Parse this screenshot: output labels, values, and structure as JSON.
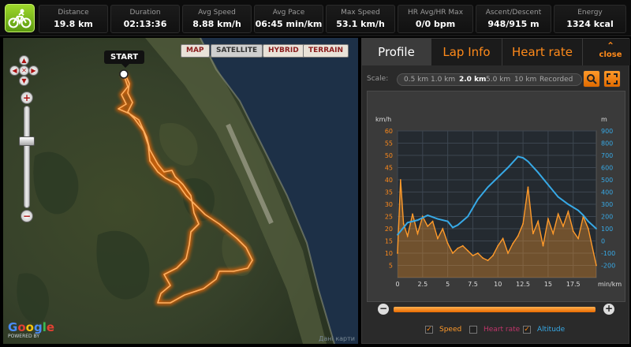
{
  "stats": [
    {
      "label": "Distance",
      "value": "19.8 km"
    },
    {
      "label": "Duration",
      "value": "02:13:36"
    },
    {
      "label": "Avg Speed",
      "value": "8.88 km/h"
    },
    {
      "label": "Avg Pace",
      "value": "06:45 min/km"
    },
    {
      "label": "Max Speed",
      "value": "53.1 km/h"
    },
    {
      "label": "HR Avg/HR Max",
      "value": "0/0 bpm"
    },
    {
      "label": "Ascent/Descent",
      "value": "948/915 m"
    },
    {
      "label": "Energy",
      "value": "1324 kcal"
    }
  ],
  "map": {
    "types": [
      "MAP",
      "SATELLITE",
      "HYBRID",
      "TERRAIN"
    ],
    "active_type": "SATELLITE",
    "start_label": "START",
    "powered_by": "POWERED BY",
    "google": "Google",
    "copyright": "Дані карти"
  },
  "panel": {
    "tabs": [
      "Profile",
      "Lap Info",
      "Heart rate"
    ],
    "active_tab": "Profile",
    "close_label": "close",
    "scale_label": "Scale:",
    "scale_options": [
      "0.5 km",
      "1.0 km",
      "2.0 km",
      "5.0 km",
      "10 km",
      "Recorded"
    ],
    "active_scale": "2.0 km",
    "legend": [
      {
        "label": "Speed",
        "checked": true,
        "color": "#ff9a2a"
      },
      {
        "label": "Heart rate",
        "checked": false,
        "color": "#c0356a"
      },
      {
        "label": "Altitude",
        "checked": true,
        "color": "#37a9e6"
      }
    ]
  },
  "chart_data": {
    "type": "area",
    "x_label": "km",
    "y_left_label": "km/h",
    "y_right_label": "m",
    "x_unit_label": "min/km",
    "x_ticks": [
      0,
      2.5,
      5,
      7.5,
      10,
      12.5,
      15,
      17.5
    ],
    "y_left_ticks": [
      5,
      10,
      15,
      20,
      25,
      30,
      35,
      40,
      45,
      50,
      55,
      60
    ],
    "y_right_ticks": [
      -200,
      -100,
      0,
      100,
      200,
      300,
      400,
      500,
      600,
      700,
      800,
      900
    ],
    "x_range": [
      0,
      19.8
    ],
    "y_left_range": [
      0,
      60
    ],
    "y_right_range": [
      -300,
      900
    ],
    "series": [
      {
        "name": "Speed",
        "color": "#ff9a2a",
        "x": [
          0,
          0.3,
          0.6,
          1,
          1.5,
          2,
          2.5,
          3,
          3.5,
          4,
          4.5,
          5,
          5.5,
          6,
          6.5,
          7,
          7.5,
          8,
          8.5,
          9,
          9.5,
          10,
          10.5,
          11,
          11.5,
          12,
          12.5,
          13,
          13.5,
          14,
          14.5,
          15,
          15.5,
          16,
          16.5,
          17,
          17.5,
          18,
          18.5,
          19,
          19.8
        ],
        "values": [
          10,
          40,
          22,
          17,
          26,
          18,
          25,
          21,
          23,
          16,
          20,
          14,
          10,
          12,
          13,
          11,
          9,
          10,
          8,
          7,
          9,
          13,
          16,
          10,
          14,
          17,
          22,
          37,
          18,
          23,
          13,
          24,
          18,
          26,
          21,
          27,
          19,
          16,
          25,
          20,
          5
        ]
      },
      {
        "name": "Altitude",
        "color": "#37a9e6",
        "x": [
          0,
          1,
          2,
          3,
          4,
          5,
          5.5,
          6,
          7,
          8,
          9,
          10,
          11,
          12,
          12.5,
          13,
          14,
          15,
          16,
          17,
          18,
          18.5,
          19,
          19.8
        ],
        "values": [
          50,
          150,
          170,
          210,
          180,
          160,
          110,
          130,
          200,
          340,
          440,
          520,
          600,
          690,
          680,
          650,
          560,
          460,
          360,
          300,
          250,
          210,
          160,
          100
        ]
      }
    ]
  }
}
